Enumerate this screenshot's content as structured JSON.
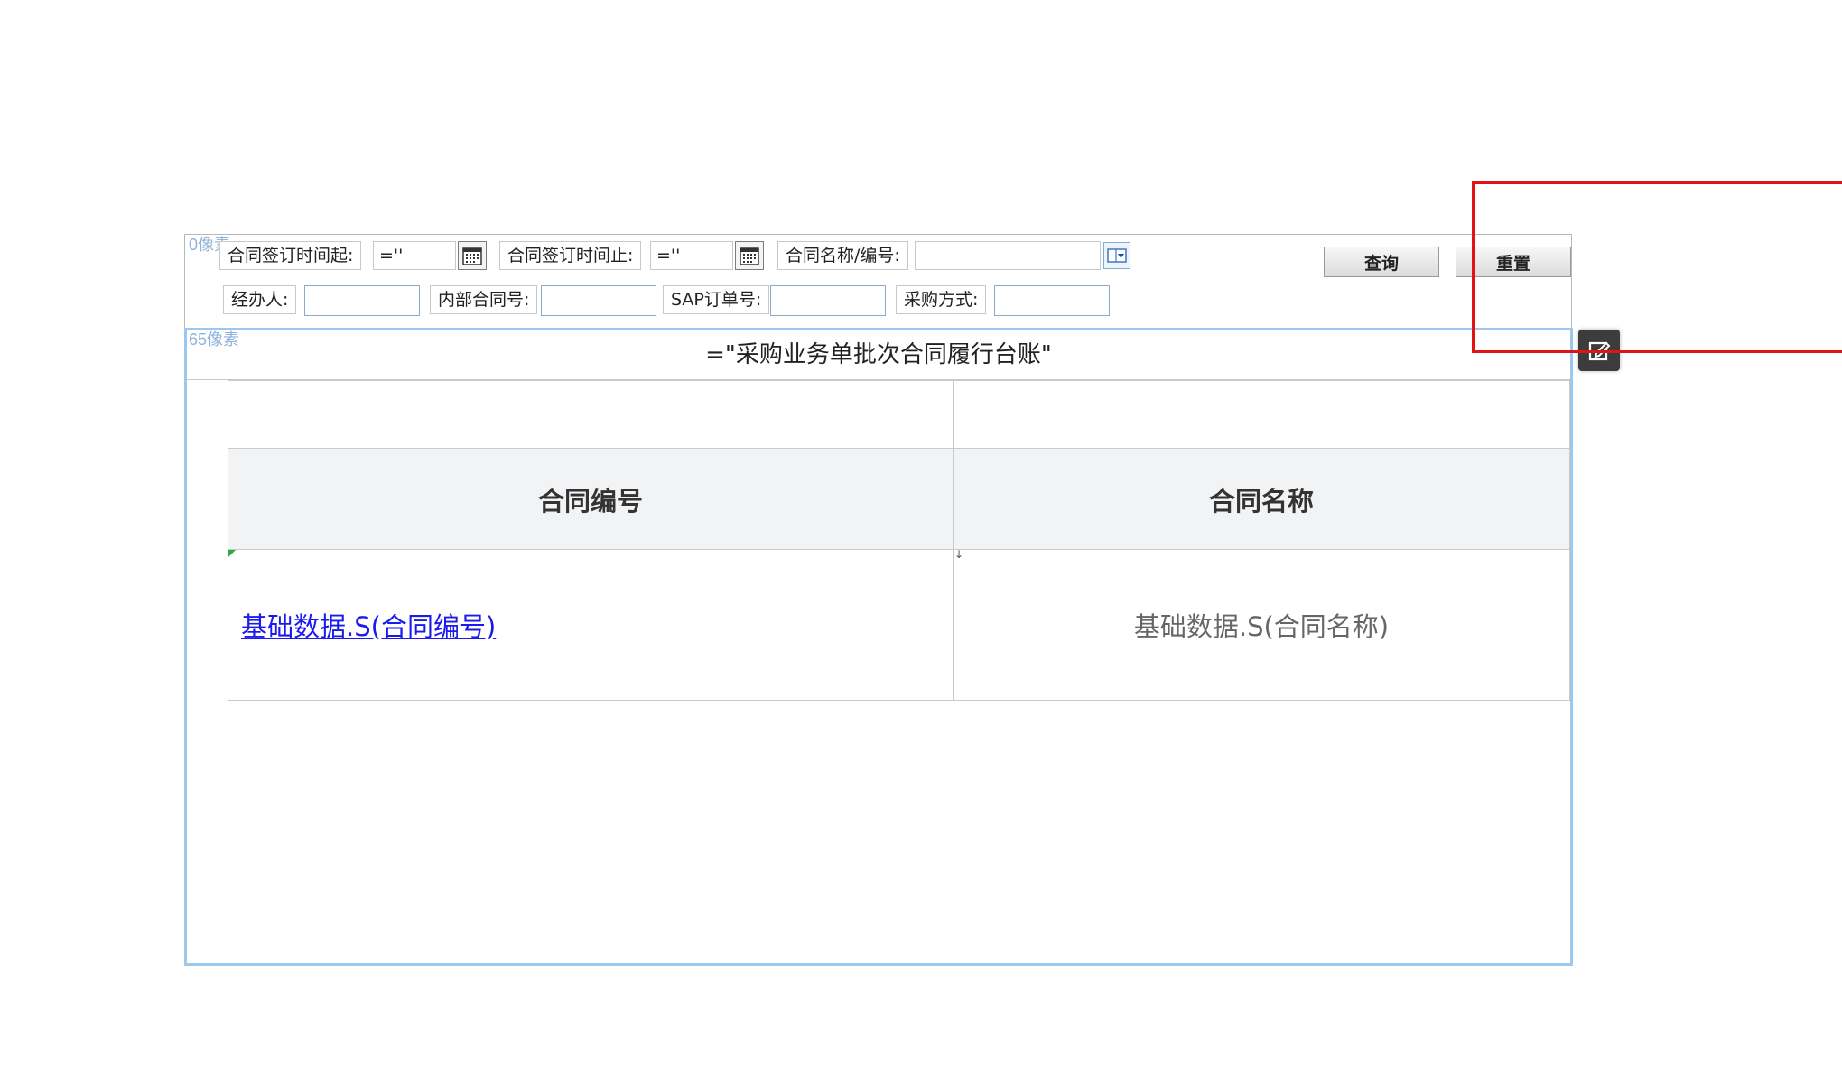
{
  "params": {
    "top_px_label": "0像素",
    "date_start_label": "合同签订时间起:",
    "date_start_value": "=''",
    "date_end_label": "合同签订时间止:",
    "date_end_value": "=''",
    "contract_name_label": "合同名称/编号:",
    "handler_label": "经办人:",
    "internal_no_label": "内部合同号:",
    "sap_label": "SAP订单号:",
    "purchase_method_label": "采购方式:",
    "query_button": "查询",
    "reset_button": "重置"
  },
  "report": {
    "px_label": "65像素",
    "title": "=\"采购业务单批次合同履行台账\"",
    "columns": [
      "合同编号",
      "合同名称"
    ],
    "row": {
      "contract_no": "基础数据.S(合同编号)",
      "contract_name": "基础数据.S(合同名称)"
    }
  },
  "icons": {
    "calendar": "calendar-icon",
    "dropdown": "dropdown-icon",
    "edit": "edit-icon"
  },
  "colors": {
    "selection_border": "#9cc7ee",
    "link": "#1a1aee",
    "highlight_box": "#e01414"
  }
}
